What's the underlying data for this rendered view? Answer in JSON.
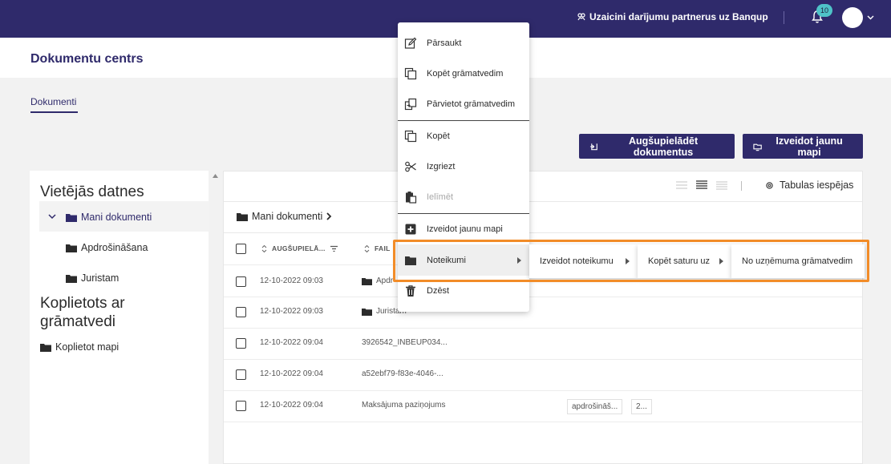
{
  "topbar": {
    "invite_text": "Uzaicini darījumu partnerus uz Banqup",
    "notification_count": "10"
  },
  "header": {
    "title": "Dokumentu centrs"
  },
  "tabs": {
    "documents": "Dokumenti"
  },
  "actions": {
    "upload": "Augšupielādēt dokumentus",
    "new_folder": "Izveidot jaunu mapi"
  },
  "tree": {
    "local_files_title": "Vietējās datnes",
    "my_documents": "Mani dokumenti",
    "folder_insurance": "Apdrošināšana",
    "folder_lawyer": "Juristam",
    "shared_title": "Koplietots ar grāmatvedi",
    "shared_folders": "Koplietot mapi"
  },
  "filepanel": {
    "table_options": "Tabulas iespējas",
    "breadcrumb": "Mani dokumenti",
    "columns": {
      "uploaded": "AUGŠUPIELĀ...",
      "file": "FAIL"
    }
  },
  "rows": [
    {
      "date": "12-10-2022 09:03",
      "name": "Apdr",
      "type": "folder"
    },
    {
      "date": "12-10-2022 09:03",
      "name": "Juristam",
      "type": "folder"
    },
    {
      "date": "12-10-2022 09:04",
      "name": "3926542_INBEUP034...",
      "type": "file"
    },
    {
      "date": "12-10-2022 09:04",
      "name": "a52ebf79-f83e-4046-...",
      "type": "file"
    },
    {
      "date": "12-10-2022 09:04",
      "name": "Maksājuma paziņojums",
      "type": "file",
      "tags": [
        "apdrošināš...",
        "2..."
      ]
    }
  ],
  "context_menu": {
    "rename": "Pārsaukt",
    "copy_to_accountant": "Kopēt grāmatvedim",
    "move_to_accountant": "Pārvietot grāmatvedim",
    "copy": "Kopēt",
    "cut": "Izgriezt",
    "paste": "Ielīmēt",
    "new_folder": "Izveidot jaunu mapi",
    "rules": "Noteikumi",
    "delete": "Dzēst"
  },
  "submenus": {
    "create_rules": "Izveidot noteikumu",
    "copy_content_to": "Kopēt saturu uz",
    "from_company_accountant": "No uzņēmuma grāmatvedim"
  },
  "colors": {
    "brand": "#2f2a6b",
    "highlight_border": "#f28c28",
    "badge": "#4fc3c8"
  }
}
